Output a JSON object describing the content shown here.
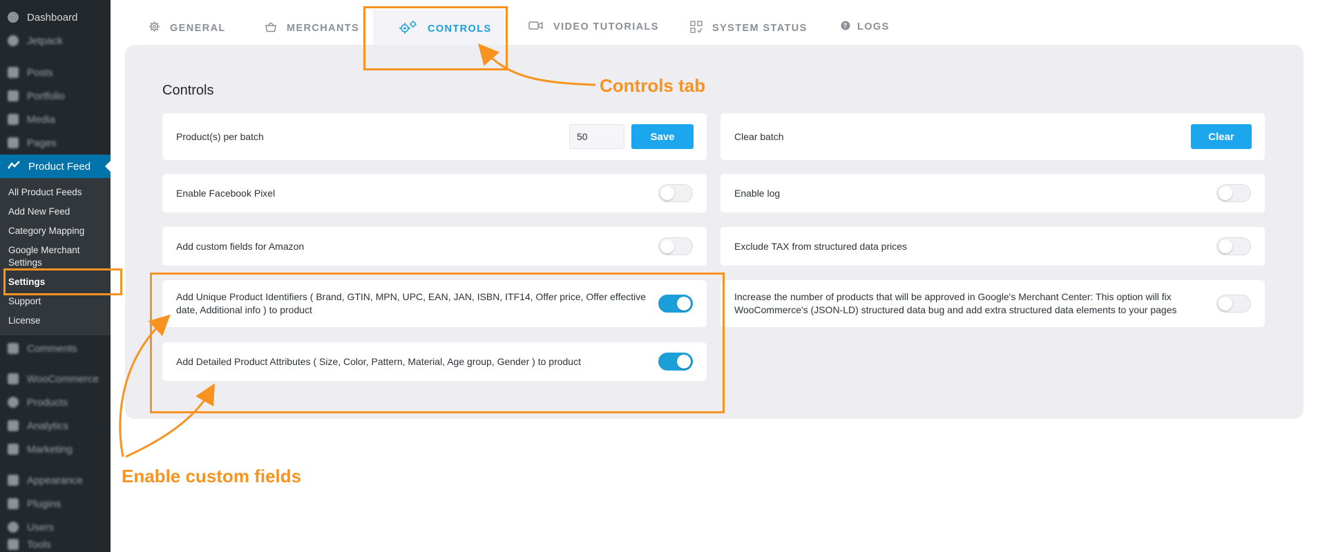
{
  "sidebar": {
    "dashboard": "Dashboard",
    "jetpack": "Jetpack",
    "posts": "Posts",
    "portfolio": "Portfolio",
    "media": "Media",
    "pages": "Pages",
    "product_feed": "Product Feed",
    "submenu": [
      "All Product Feeds",
      "Add New Feed",
      "Category Mapping",
      "Google Merchant Settings",
      "Settings",
      "Support",
      "License"
    ],
    "comments": "Comments",
    "woocommerce": "WooCommerce",
    "products": "Products",
    "analytics": "Analytics",
    "marketing": "Marketing",
    "appearance": "Appearance",
    "plugins": "Plugins",
    "users": "Users",
    "tools": "Tools"
  },
  "tabs": [
    "GENERAL",
    "MERCHANTS",
    "CONTROLS",
    "VIDEO TUTORIALS",
    "SYSTEM STATUS",
    "LOGS"
  ],
  "active_tab": "CONTROLS",
  "panel": {
    "title": "Controls",
    "left": {
      "batch_label": "Product(s) per batch",
      "batch_value": "50",
      "save_label": "Save",
      "facebook_pixel_label": "Enable Facebook Pixel",
      "facebook_pixel_on": false,
      "amazon_label": "Add custom fields for Amazon",
      "amazon_on": false,
      "identifiers_label": "Add Unique Product Identifiers ( Brand, GTIN, MPN, UPC, EAN, JAN, ISBN, ITF14, Offer price, Offer effective date, Additional info ) to product",
      "identifiers_on": true,
      "attributes_label": "Add Detailed Product Attributes ( Size, Color, Pattern, Material, Age group, Gender ) to product",
      "attributes_on": true
    },
    "right": {
      "clear_batch_label": "Clear batch",
      "clear_label": "Clear",
      "enable_log_label": "Enable log",
      "enable_log_on": false,
      "exclude_tax_label": "Exclude TAX from structured data prices",
      "exclude_tax_on": false,
      "increase_label": "Increase the number of products that will be approved in Google's Merchant Center: This option will fix WooCommerce's (JSON-LD) structured data bug and add extra structured data elements to your pages",
      "increase_on": false
    }
  },
  "annotations": {
    "controls_tab": "Controls tab",
    "enable_custom_fields": "Enable custom fields"
  },
  "colors": {
    "annotation": "#f7931e",
    "accent": "#1b9fd8",
    "sidebar_bg": "#23282d",
    "sidebar_active": "#0073aa"
  }
}
